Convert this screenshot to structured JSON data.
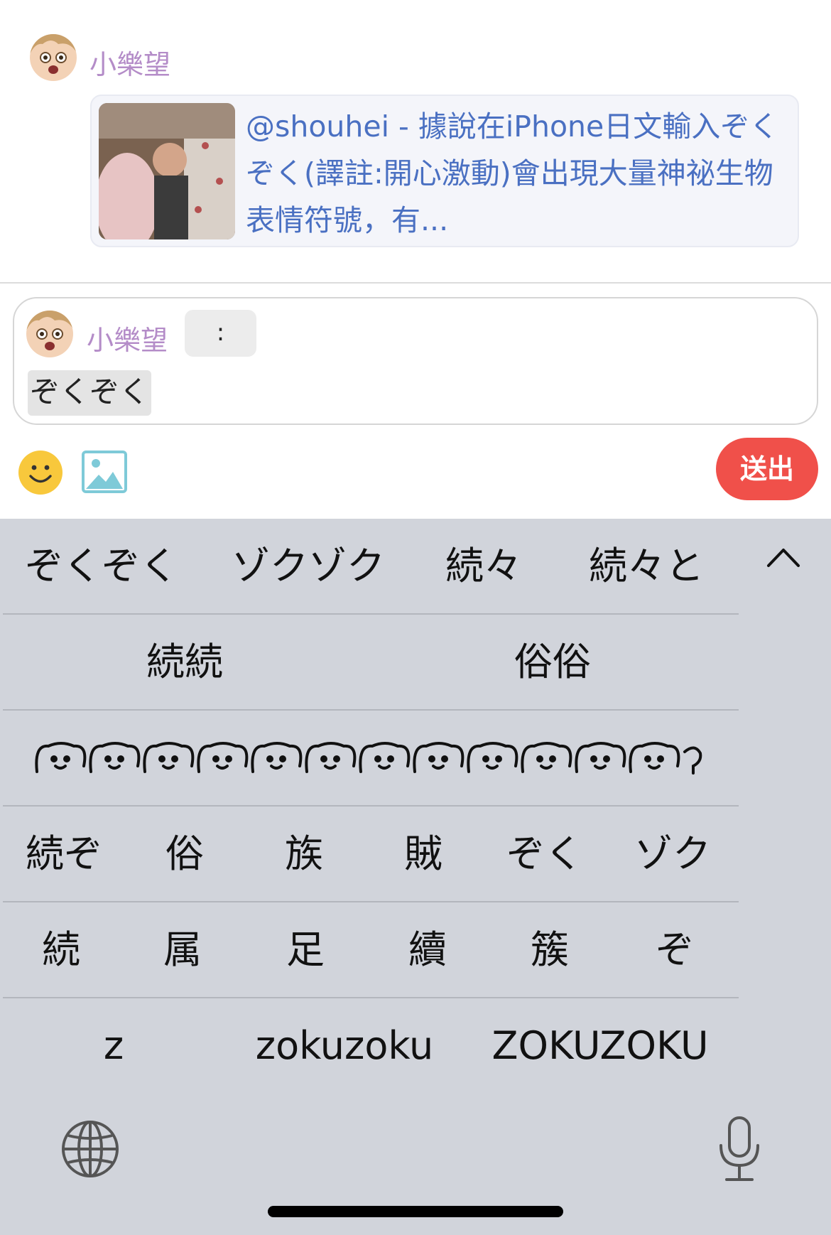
{
  "post": {
    "author": "小樂望",
    "link_text": "@shouhei - 據說在iPhone日文輸入ぞくぞく(譯註:開心激動)會出現大量神祕生物表情符號，有..."
  },
  "composer": {
    "author": "小樂望",
    "chip_text": ":",
    "input_text": "ぞくぞく",
    "send_label": "送出"
  },
  "keyboard": {
    "row1": [
      "ぞくぞく",
      "ゾクゾク",
      "続々",
      "続々と"
    ],
    "row2": [
      "続続",
      "俗俗"
    ],
    "row4": [
      "続ぞ",
      "俗",
      "族",
      "賊",
      "ぞく",
      "ゾク"
    ],
    "row5": [
      "続",
      "属",
      "足",
      "續",
      "簇",
      "ぞ"
    ],
    "row6": [
      "z",
      "zokuzoku",
      "ZOKUZOKU"
    ]
  },
  "colors": {
    "author": "#b48cc8",
    "link": "#4a70c2",
    "send": "#f0504a",
    "keyboard_bg": "#d1d4db"
  },
  "icons": [
    "avatar",
    "link-thumbnail",
    "smile-emoji-icon",
    "image-icon",
    "chevron-up-icon",
    "globe-icon",
    "microphone-icon",
    "emoticon-icon"
  ]
}
